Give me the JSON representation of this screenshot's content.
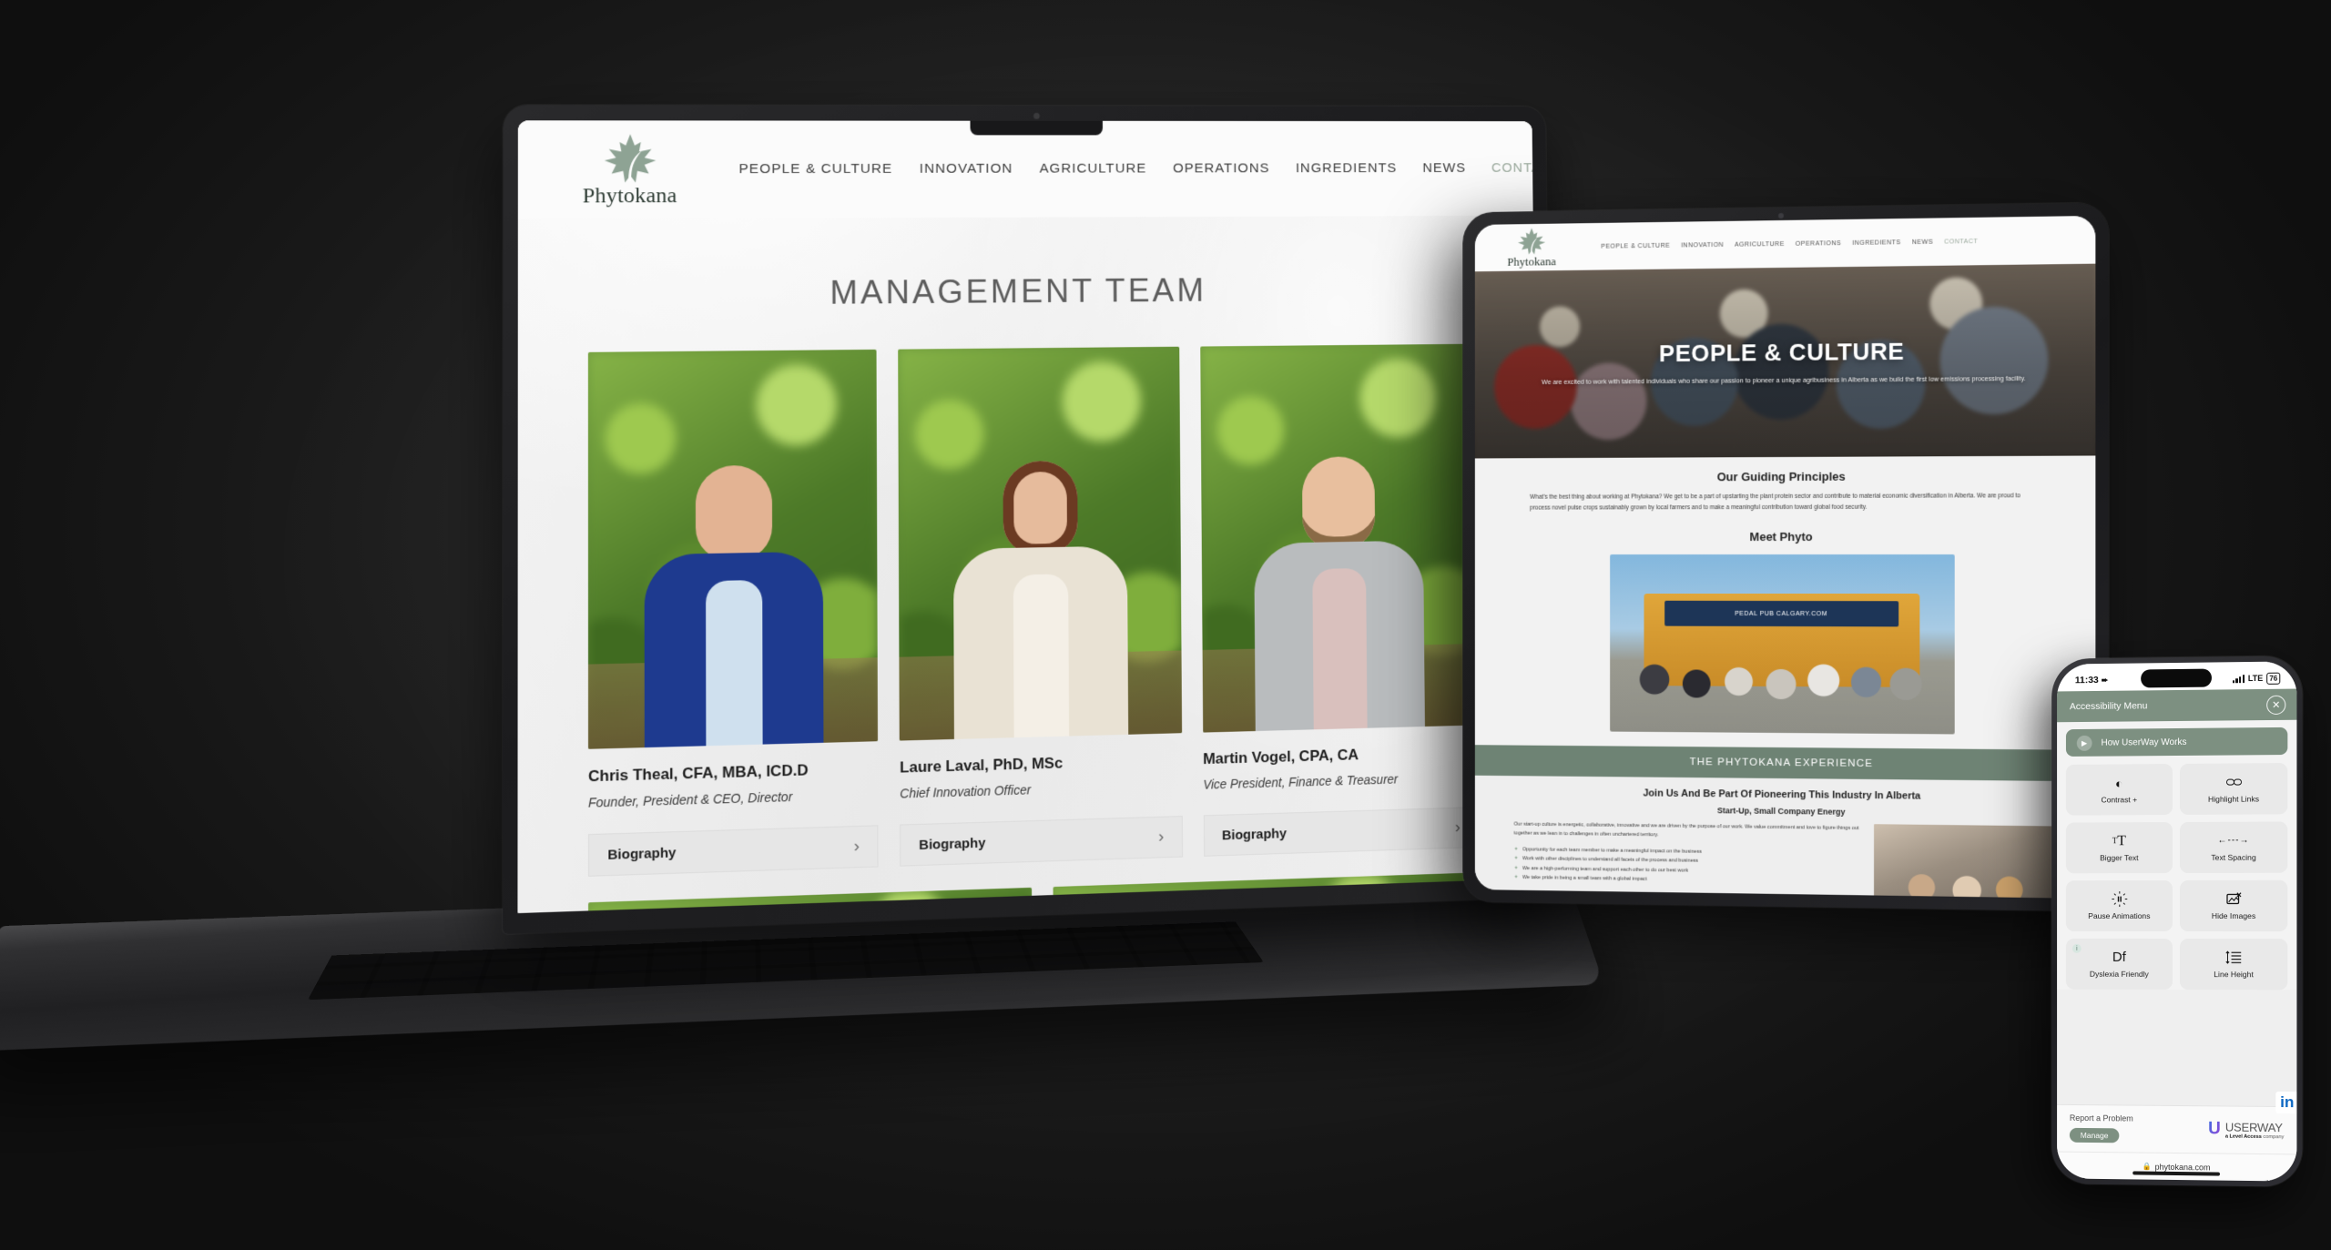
{
  "site": {
    "brand": {
      "name": "Phytokana",
      "logo_icon": "maple-leaf-icon",
      "color": "#8ea394"
    },
    "nav": [
      {
        "label": "PEOPLE & CULTURE",
        "active": false
      },
      {
        "label": "INNOVATION",
        "active": false
      },
      {
        "label": "AGRICULTURE",
        "active": false
      },
      {
        "label": "OPERATIONS",
        "active": false
      },
      {
        "label": "INGREDIENTS",
        "active": false
      },
      {
        "label": "NEWS",
        "active": false
      },
      {
        "label": "CONTACT",
        "active": true
      }
    ]
  },
  "laptop": {
    "page_title": "MANAGEMENT TEAM",
    "team": [
      {
        "name": "Chris Theal, CFA, MBA, ICD.D",
        "role": "Founder, President & CEO, Director",
        "bio_label": "Biography",
        "chevron": "›",
        "suit_color": "#1e3a8f",
        "shirt_color": "#cfe0ee",
        "skin_color": "#e3b393"
      },
      {
        "name": "Laure Laval, PhD, MSc",
        "role": "Chief Innovation Officer",
        "bio_label": "Biography",
        "chevron": "›",
        "suit_color": "#e9e2d4",
        "shirt_color": "#f4efe6",
        "skin_color": "#e6bb9c"
      },
      {
        "name": "Martin Vogel, CPA, CA",
        "role": "Vice President, Finance & Treasurer",
        "bio_label": "Biography",
        "chevron": "›",
        "suit_color": "#b9bcbe",
        "shirt_color": "#d9c0bd",
        "skin_color": "#e8bf9e"
      }
    ]
  },
  "tablet": {
    "hero": {
      "title": "PEOPLE & CULTURE",
      "subtitle": "We are excited to work with talented individuals who share our passion to pioneer a unique agribusiness in Alberta as we build the first low emissions processing facility."
    },
    "guiding": {
      "heading": "Our Guiding Principles",
      "body": "What's the best thing about working at Phytokana? We get to be a part of upstarting the plant protein sector and contribute to material economic diversification in Alberta. We are proud to process novel pulse crops sustainably grown by local farmers and to make a meaningful contribution toward global food security."
    },
    "meet": {
      "heading": "Meet Phyto",
      "photo_caption": "PEDAL PUB CALGARY.COM"
    },
    "experience_banner": "THE PHYTOKANA EXPERIENCE",
    "experience": {
      "heading": "Join Us And Be Part Of Pioneering This Industry In Alberta",
      "subheading": "Start-Up, Small Company Energy",
      "body": "Our start-up culture is energetic, collaborative, innovative and we are driven by the purpose of our work. We value commitment and love to figure things out together as we lean in to challenges in often unchartered territory.",
      "bullets": [
        "Opportunity for each team member to make a meaningful impact on the business",
        "Work with other disciplines to understand all facets of the process and business",
        "We are a high-performing team and support each other to do our best work",
        "We take pride in being a small team with a global impact"
      ]
    }
  },
  "phone": {
    "status": {
      "time": "11:33",
      "location_icon": "location-arrow-icon",
      "network": "LTE",
      "battery": "76"
    },
    "accessibility": {
      "title": "Accessibility Menu",
      "close_icon": "close-icon",
      "howto_label": "How UserWay Works",
      "play_icon": "play-icon",
      "tiles": [
        {
          "label": "Contrast +",
          "icon": "contrast-icon",
          "glyph": "◐",
          "badge": ""
        },
        {
          "label": "Highlight Links",
          "icon": "link-icon",
          "glyph": "⚭",
          "badge": ""
        },
        {
          "label": "Bigger Text",
          "icon": "bigger-text-icon",
          "glyph": "тT",
          "badge": ""
        },
        {
          "label": "Text Spacing",
          "icon": "text-spacing-icon",
          "glyph": "←--→",
          "badge": ""
        },
        {
          "label": "Pause Animations",
          "icon": "pause-animations-icon",
          "glyph": "⏸",
          "badge": ""
        },
        {
          "label": "Hide Images",
          "icon": "hide-images-icon",
          "glyph": "⛶",
          "badge": ""
        },
        {
          "label": "Dyslexia Friendly",
          "icon": "dyslexia-friendly-icon",
          "glyph": "Df",
          "badge": "i"
        },
        {
          "label": "Line Height",
          "icon": "line-height-icon",
          "glyph": "↕≡",
          "badge": ""
        }
      ],
      "report_label": "Report a Problem",
      "manage_label": "Manage",
      "vendor": {
        "name_bold": "USER",
        "name_light": "WAY",
        "tagline_bold": "a Level Access",
        "tagline_rest": " company",
        "logo_icon": "userway-logo-icon"
      }
    },
    "url": {
      "lock_icon": "lock-icon",
      "text": "phytokana.com"
    },
    "social": {
      "linkedin_icon": "linkedin-icon",
      "label": "in"
    }
  }
}
